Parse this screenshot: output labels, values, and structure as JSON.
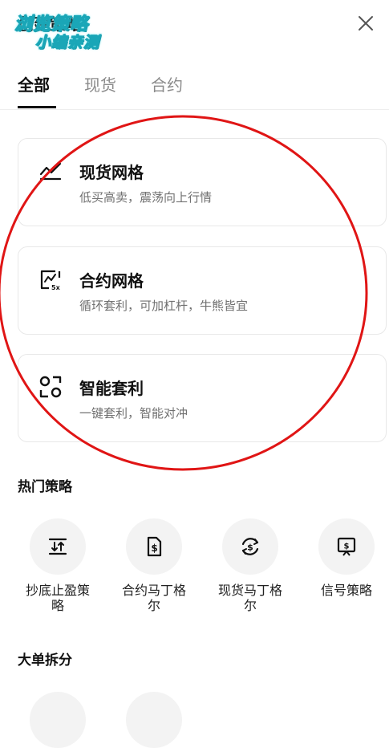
{
  "header": {
    "title": "创建策略",
    "close_icon": "close-icon"
  },
  "watermark": {
    "line1": "浏览策略",
    "line2": "小编亲测"
  },
  "tabs": [
    {
      "label": "全部",
      "active": true
    },
    {
      "label": "现货",
      "active": false
    },
    {
      "label": "合约",
      "active": false
    }
  ],
  "cards": [
    {
      "title": "现货网格",
      "desc": "低买高卖，震荡向上行情",
      "icon": "spot-grid-icon"
    },
    {
      "title": "合约网格",
      "desc": "循环套利，可加杠杆，牛熊皆宜",
      "icon": "futures-grid-icon",
      "icon_badge": "5x"
    },
    {
      "title": "智能套利",
      "desc": "一键套利，智能对冲",
      "icon": "smart-arbitrage-icon"
    }
  ],
  "hot": {
    "title": "热门策略",
    "items": [
      {
        "label": "抄底止盈策略",
        "icon": "buy-dip-icon"
      },
      {
        "label": "合约马丁格尔",
        "icon": "futures-martingale-icon"
      },
      {
        "label": "现货马丁格尔",
        "icon": "spot-martingale-icon"
      },
      {
        "label": "信号策略",
        "icon": "signal-strategy-icon"
      }
    ]
  },
  "split": {
    "title": "大单拆分"
  },
  "colors": {
    "annotation_circle": "#e01515",
    "watermark_stroke": "#1aa6b7"
  }
}
